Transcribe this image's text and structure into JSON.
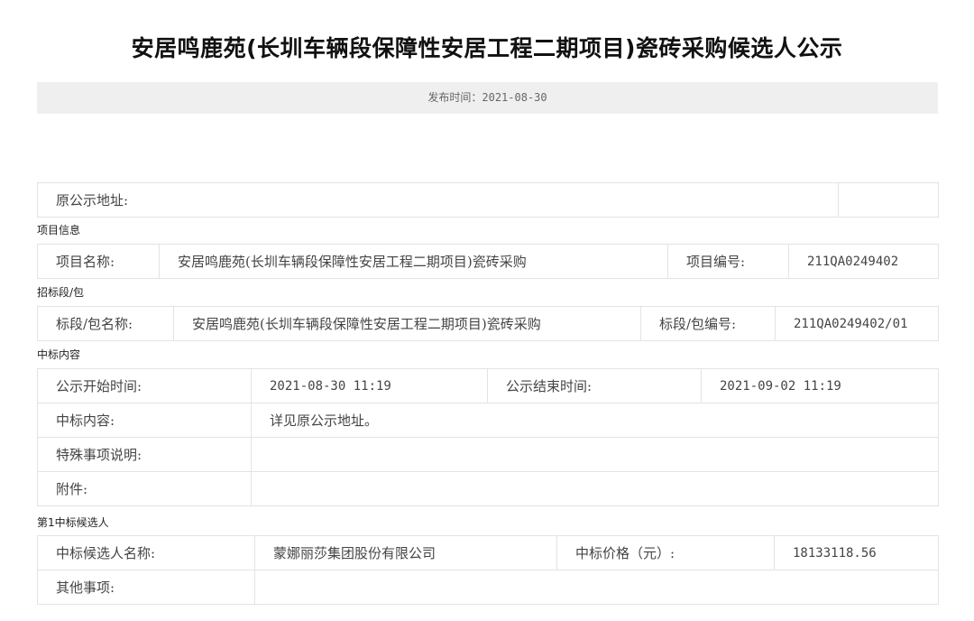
{
  "title": "安居鸣鹿苑(长圳车辆段保障性安居工程二期项目)瓷砖采购候选人公示",
  "publish": "发布时间：2021-08-30",
  "source_row": {
    "label": "原公示地址:",
    "value": ""
  },
  "project_info": {
    "heading": "项目信息",
    "name_label": "项目名称:",
    "name_value": "安居鸣鹿苑(长圳车辆段保障性安居工程二期项目)瓷砖采购",
    "code_label": "项目编号:",
    "code_value": "211QA0249402"
  },
  "section_info": {
    "heading": "招标段/包",
    "name_label": "标段/包名称:",
    "name_value": "安居鸣鹿苑(长圳车辆段保障性安居工程二期项目)瓷砖采购",
    "code_label": "标段/包编号:",
    "code_value": "211QA0249402/01"
  },
  "award": {
    "heading": "中标内容",
    "start_label": "公示开始时间:",
    "start_value": "2021-08-30 11:19",
    "end_label": "公示结束时间:",
    "end_value": "2021-09-02 11:19",
    "content_label": "中标内容:",
    "content_value": "详见原公示地址。",
    "special_label": "特殊事项说明:",
    "special_value": "",
    "attach_label": "附件:",
    "attach_value": ""
  },
  "candidate": {
    "heading": "第1中标候选人",
    "name_label": "中标候选人名称:",
    "name_value": "蒙娜丽莎集团股份有限公司",
    "price_label": "中标价格（元）:",
    "price_value": "18133118.56",
    "other_label": "其他事项:",
    "other_value": ""
  }
}
